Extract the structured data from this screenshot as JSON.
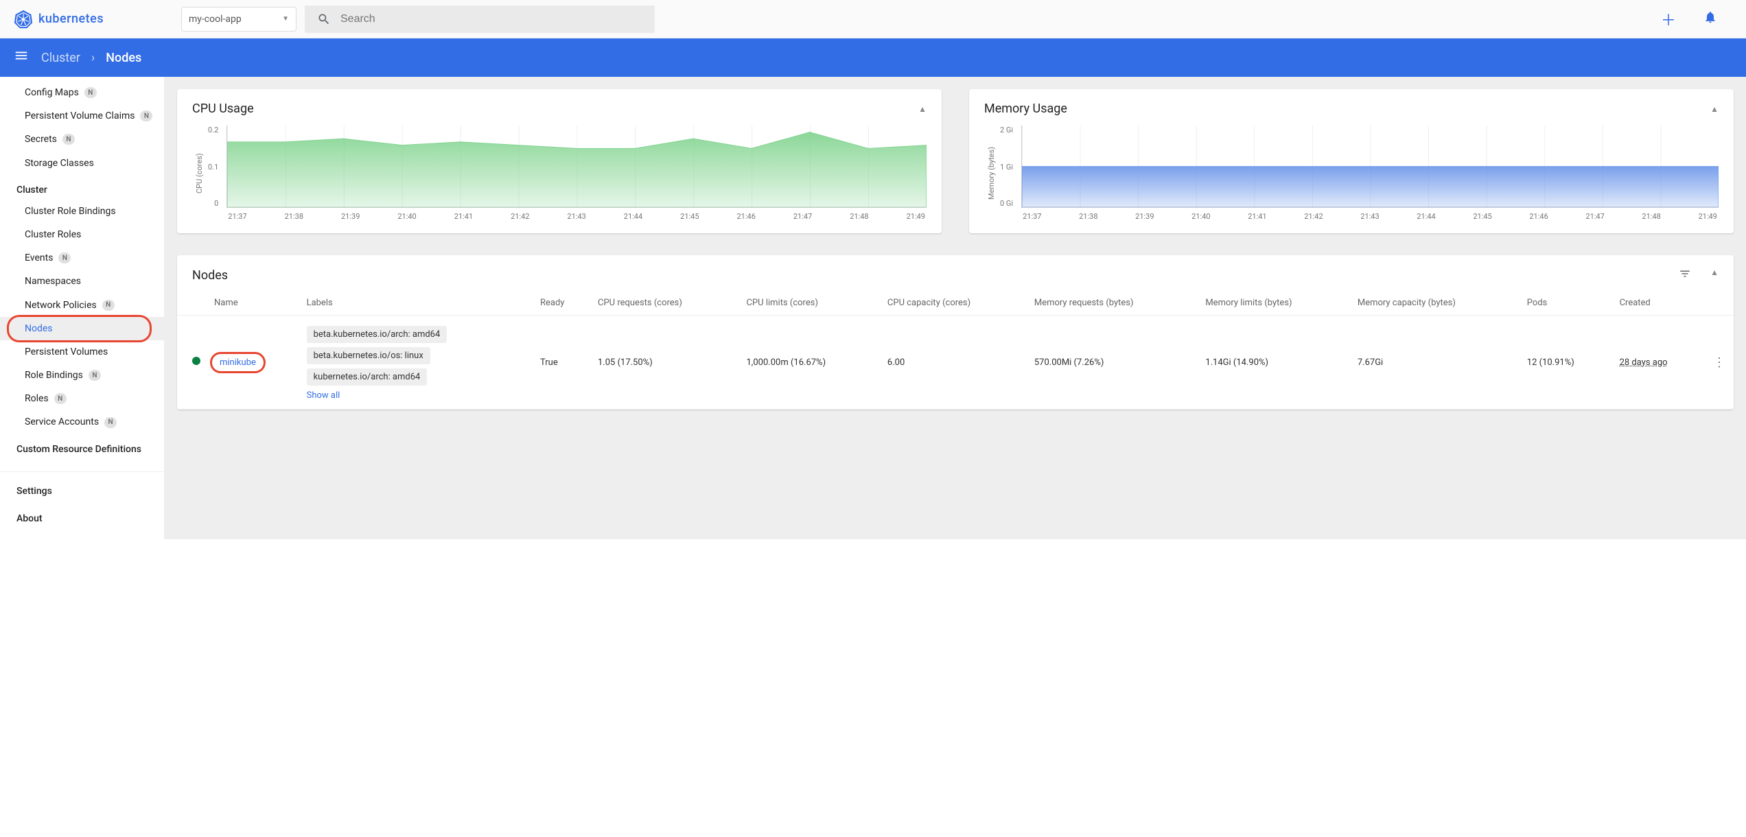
{
  "topbar": {
    "app_name": "kubernetes",
    "namespace_selected": "my-cool-app",
    "search_placeholder": "Search"
  },
  "breadcrumb": {
    "parent": "Cluster",
    "current": "Nodes"
  },
  "sidebar": {
    "config_group": [
      {
        "label": "Config Maps",
        "badge": "N"
      },
      {
        "label": "Persistent Volume Claims",
        "badge": "N"
      },
      {
        "label": "Secrets",
        "badge": "N"
      },
      {
        "label": "Storage Classes",
        "badge": ""
      }
    ],
    "cluster_heading": "Cluster",
    "cluster_group": [
      {
        "label": "Cluster Role Bindings",
        "badge": ""
      },
      {
        "label": "Cluster Roles",
        "badge": ""
      },
      {
        "label": "Events",
        "badge": "N"
      },
      {
        "label": "Namespaces",
        "badge": ""
      },
      {
        "label": "Network Policies",
        "badge": "N"
      },
      {
        "label": "Nodes",
        "badge": "",
        "active": true,
        "highlight": true
      },
      {
        "label": "Persistent Volumes",
        "badge": ""
      },
      {
        "label": "Role Bindings",
        "badge": "N"
      },
      {
        "label": "Roles",
        "badge": "N"
      },
      {
        "label": "Service Accounts",
        "badge": "N"
      }
    ],
    "crd_heading": "Custom Resource Definitions",
    "settings": "Settings",
    "about": "About"
  },
  "charts": {
    "cpu": {
      "title": "CPU Usage",
      "ylabel": "CPU (cores)",
      "yticks": [
        "0.2",
        "0.1",
        "0"
      ]
    },
    "memory": {
      "title": "Memory Usage",
      "ylabel": "Memory (bytes)",
      "yticks": [
        "2 Gi",
        "1 Gi",
        "0 Gi"
      ]
    },
    "xticks": [
      "21:37",
      "21:38",
      "21:39",
      "21:40",
      "21:41",
      "21:42",
      "21:43",
      "21:44",
      "21:45",
      "21:46",
      "21:47",
      "21:48",
      "21:49"
    ]
  },
  "chart_data": [
    {
      "type": "area",
      "title": "CPU Usage",
      "xlabel": "",
      "ylabel": "CPU (cores)",
      "ylim": [
        0,
        0.25
      ],
      "x": [
        "21:37",
        "21:38",
        "21:39",
        "21:40",
        "21:41",
        "21:42",
        "21:43",
        "21:44",
        "21:45",
        "21:46",
        "21:47",
        "21:48",
        "21:49"
      ],
      "values": [
        0.2,
        0.2,
        0.21,
        0.19,
        0.2,
        0.19,
        0.18,
        0.18,
        0.21,
        0.18,
        0.23,
        0.18,
        0.19
      ],
      "color": "#7ed28c"
    },
    {
      "type": "area",
      "title": "Memory Usage",
      "xlabel": "",
      "ylabel": "Memory (bytes)",
      "ylim": [
        0,
        2
      ],
      "x": [
        "21:37",
        "21:38",
        "21:39",
        "21:40",
        "21:41",
        "21:42",
        "21:43",
        "21:44",
        "21:45",
        "21:46",
        "21:47",
        "21:48",
        "21:49"
      ],
      "values": [
        1.0,
        1.0,
        1.0,
        1.0,
        1.0,
        1.0,
        1.0,
        1.0,
        1.0,
        1.0,
        1.0,
        1.0,
        1.0
      ],
      "units": "Gi",
      "color": "#6a95ea"
    }
  ],
  "nodes_table": {
    "title": "Nodes",
    "columns": [
      "Name",
      "Labels",
      "Ready",
      "CPU requests (cores)",
      "CPU limits (cores)",
      "CPU capacity (cores)",
      "Memory requests (bytes)",
      "Memory limits (bytes)",
      "Memory capacity (bytes)",
      "Pods",
      "Created"
    ],
    "rows": [
      {
        "status": "green",
        "name": "minikube",
        "name_highlight": true,
        "labels": [
          "beta.kubernetes.io/arch: amd64",
          "beta.kubernetes.io/os: linux",
          "kubernetes.io/arch: amd64"
        ],
        "show_all": "Show all",
        "ready": "True",
        "cpu_requests": "1.05 (17.50%)",
        "cpu_limits": "1,000.00m (16.67%)",
        "cpu_capacity": "6.00",
        "mem_requests": "570.00Mi (7.26%)",
        "mem_limits": "1.14Gi (14.90%)",
        "mem_capacity": "7.67Gi",
        "pods": "12 (10.91%)",
        "created": "28 days ago"
      }
    ]
  }
}
